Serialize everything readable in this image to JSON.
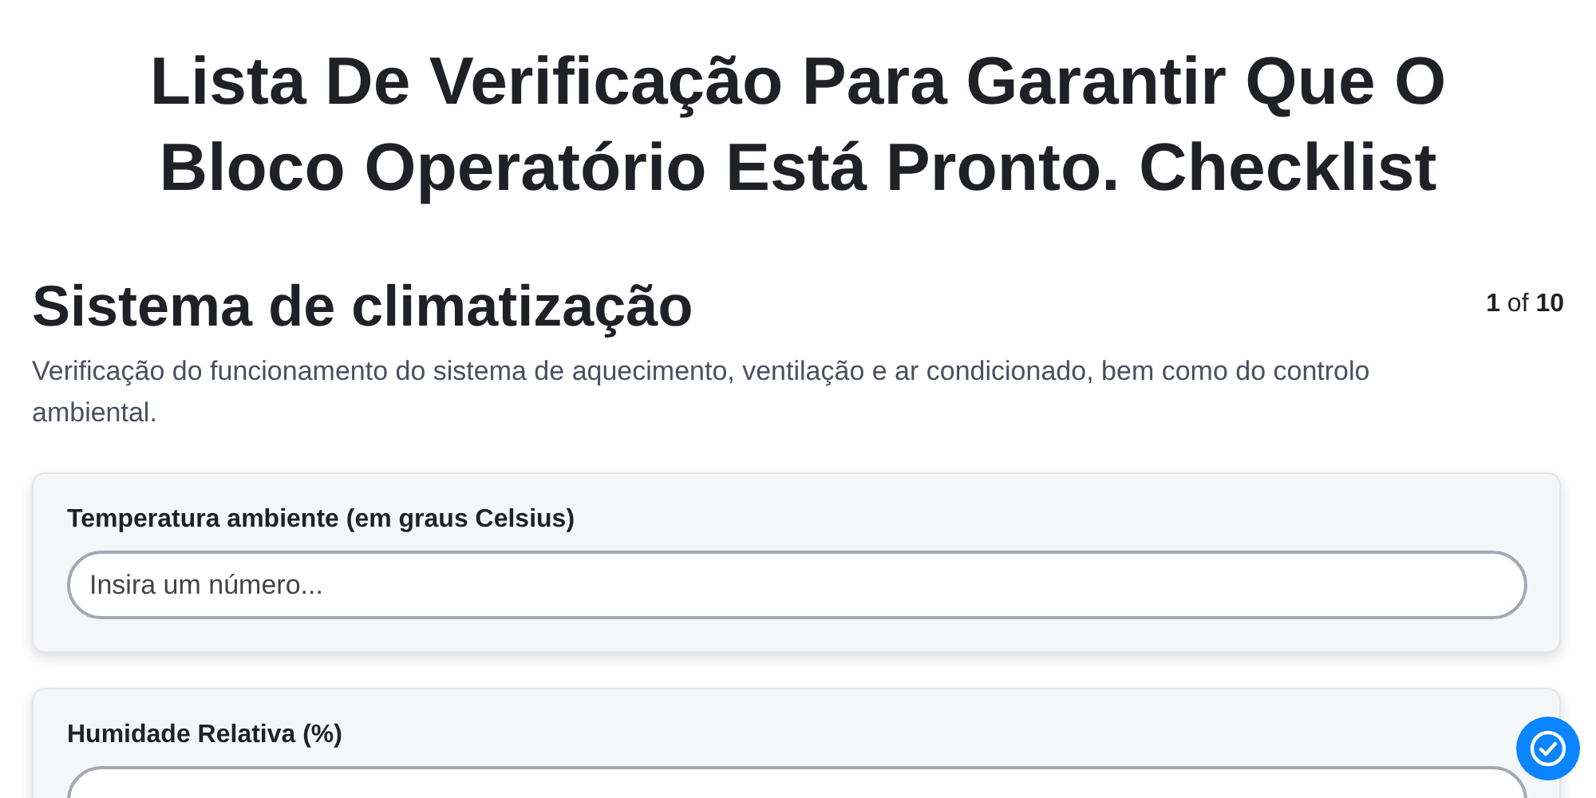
{
  "title": "Lista De Verificação Para Garantir Que O Bloco Operatório Está Pronto. Checklist",
  "section": {
    "heading": "Sistema de climatização",
    "progress": "**1** of **10**",
    "description": "Verificação do funcionamento do sistema de aquecimento, ventilação e ar condicionado, bem como do controlo ambiental."
  },
  "questions": [
    {
      "label": "Temperatura ambiente (em graus Celsius)",
      "placeholder": "Insira um número..."
    },
    {
      "label": "Humidade Relativa (%)"
    }
  ]
}
